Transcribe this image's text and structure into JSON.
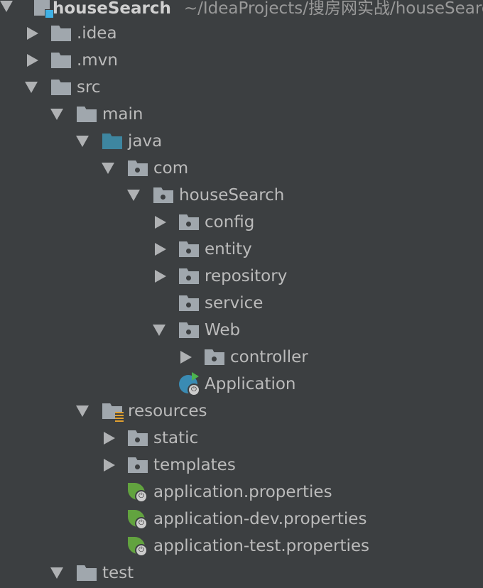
{
  "project": {
    "name": "houseSearch",
    "path": "~/IdeaProjects/搜房网实战/houseSearch"
  },
  "nodes": [
    {
      "label": ".idea",
      "level": 1,
      "arrow": "right",
      "icon": "folder-icon"
    },
    {
      "label": ".mvn",
      "level": 1,
      "arrow": "right",
      "icon": "folder-icon"
    },
    {
      "label": "src",
      "level": 1,
      "arrow": "down",
      "icon": "folder-icon"
    },
    {
      "label": "main",
      "level": 2,
      "arrow": "down",
      "icon": "folder-icon"
    },
    {
      "label": "java",
      "level": 3,
      "arrow": "down",
      "icon": "source-folder-icon"
    },
    {
      "label": "com",
      "level": 4,
      "arrow": "down",
      "icon": "package-icon"
    },
    {
      "label": "houseSearch",
      "level": 5,
      "arrow": "down",
      "icon": "package-icon"
    },
    {
      "label": "config",
      "level": 6,
      "arrow": "right",
      "icon": "package-icon"
    },
    {
      "label": "entity",
      "level": 6,
      "arrow": "right",
      "icon": "package-icon"
    },
    {
      "label": "repository",
      "level": 6,
      "arrow": "right",
      "icon": "package-icon"
    },
    {
      "label": "service",
      "level": 6,
      "arrow": "none",
      "icon": "package-icon"
    },
    {
      "label": "Web",
      "level": 6,
      "arrow": "down",
      "icon": "package-icon"
    },
    {
      "label": "controller",
      "level": 7,
      "arrow": "right",
      "icon": "package-icon"
    },
    {
      "label": "Application",
      "level": 6,
      "arrow": "none",
      "icon": "spring-boot-application-icon"
    },
    {
      "label": "resources",
      "level": 3,
      "arrow": "down",
      "icon": "resources-folder-icon"
    },
    {
      "label": "static",
      "level": 4,
      "arrow": "right",
      "icon": "package-icon"
    },
    {
      "label": "templates",
      "level": 4,
      "arrow": "right",
      "icon": "package-icon"
    },
    {
      "label": "application.properties",
      "level": 4,
      "arrow": "none",
      "icon": "spring-properties-icon"
    },
    {
      "label": "application-dev.properties",
      "level": 4,
      "arrow": "none",
      "icon": "spring-properties-icon"
    },
    {
      "label": "application-test.properties",
      "level": 4,
      "arrow": "none",
      "icon": "spring-properties-icon"
    },
    {
      "label": "test",
      "level": 2,
      "arrow": "down",
      "icon": "folder-icon"
    }
  ]
}
